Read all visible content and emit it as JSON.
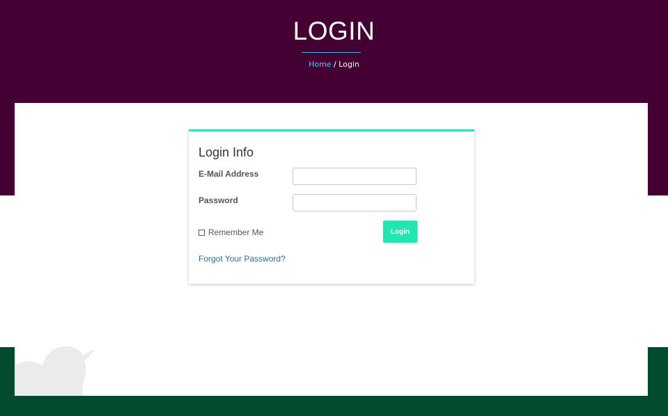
{
  "header": {
    "title": "LOGIN",
    "breadcrumb": {
      "home": "Home",
      "separator": " / ",
      "current": "Login"
    }
  },
  "colors": {
    "header_bg": "#440033",
    "footer_bg": "#034a2e",
    "accent": "#27e0c2",
    "button": "#1ee8b0",
    "link": "#2a6f96",
    "breadcrumb_link": "#36d4ec"
  },
  "login_card": {
    "title": "Login Info",
    "email_label": "E-Mail Address",
    "email_value": "",
    "password_label": "Password",
    "password_value": "",
    "remember_label": "Remember Me",
    "remember_checked": false,
    "submit_label": "Login",
    "forgot_link": "Forgot Your Password?"
  },
  "decorations": {
    "watermark_icon": "bird-icon"
  }
}
